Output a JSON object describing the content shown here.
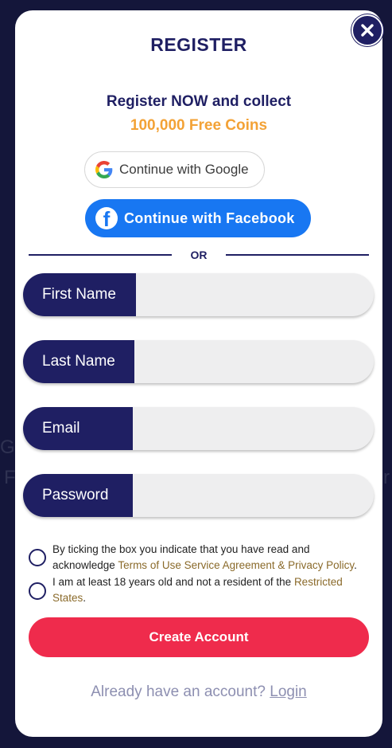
{
  "modal": {
    "title": "REGISTER",
    "promo_line1": "Register NOW and collect",
    "promo_line2": "100,000 Free Coins",
    "close_icon": "close-icon"
  },
  "social": {
    "google_label": "Continue with Google",
    "google_icon": "google-icon",
    "facebook_label": "Continue with Facebook",
    "facebook_icon": "facebook-icon",
    "divider_text": "OR"
  },
  "fields": {
    "first_name": {
      "label": "First Name",
      "value": ""
    },
    "last_name": {
      "label": "Last Name",
      "value": ""
    },
    "email": {
      "label": "Email",
      "value": ""
    },
    "password": {
      "label": "Password",
      "value": ""
    }
  },
  "consent": {
    "terms_prefix": "By ticking the box you indicate that you have read and acknowledge ",
    "terms_link": "Terms of Use Service Agreement & Privacy Policy",
    "terms_suffix": ".",
    "age_prefix": "I am at least 18 years old and not a resident of the ",
    "age_link": "Restricted States",
    "age_suffix": "."
  },
  "actions": {
    "create_label": "Create Account",
    "already_text": "Already have an account?",
    "login_label": "Login"
  },
  "colors": {
    "navy": "#1f1f63",
    "orange": "#f3a236",
    "facebook_blue": "#1877f2",
    "create_red": "#ef2b4c",
    "link_gold": "#8a6a2a"
  }
}
